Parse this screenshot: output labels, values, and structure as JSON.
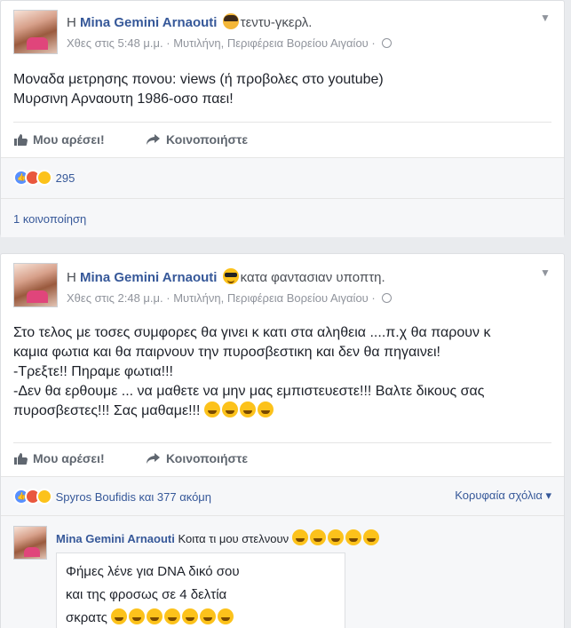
{
  "post1": {
    "author_prefix": "Η",
    "author": "Mina Gemini Arnaouti",
    "feeling_icon": "teddy-face-icon",
    "feeling": "τεντυ-γκερλ.",
    "time": "Χθες στις 5:48 μ.μ.",
    "sep": "·",
    "location": "Μυτιλήνη, Περιφέρεια Βορείου Αιγαίου",
    "sep2": "·",
    "body_line1": "Μοναδα μετρησης πονου: views (ή προβολες στο youtube)",
    "body_line2": "Μυρσινη Αρναουτη 1986-οσο παει!",
    "like_label": "Μου αρέσει!",
    "share_label": "Κοινοποιήστε",
    "reaction_count": "295",
    "shares": "1 κοινοποίηση"
  },
  "post2": {
    "author_prefix": "Η",
    "author": "Mina Gemini Arnaouti",
    "feeling_icon": "sunglasses-face-icon",
    "feeling": "κατα φαντασιαν υποπτη.",
    "time": "Χθες στις 2:48 μ.μ.",
    "sep": "·",
    "location": "Μυτιλήνη, Περιφέρεια Βορείου Αιγαίου",
    "sep2": "·",
    "body_line1": "Στο τελος με τοσες συμφορες θα γινει κ κατι στα αληθεια ....π.χ θα παρουν κ",
    "body_line2": "καμια φωτια και θα παιρνουν την πυροσβεστικη και δεν θα πηγαινει!",
    "body_line3": "-Τρεξτε!! Πηραμε φωτια!!!",
    "body_line4": "-Δεν θα ερθουμε ... να μαθετε να μην μας εμπιστευεστε!!! Βαλτε δικους σας",
    "body_line5": "πυροσβεστες!!! Σας μαθαμε!!!",
    "like_label": "Μου αρέσει!",
    "share_label": "Κοινοποιήστε",
    "reactors": "Spyros Boufidis και 377 ακόμη",
    "top_comments": "Κορυφαία σχόλια",
    "comment": {
      "author": "Mina Gemini Arnaouti",
      "text": "Κοιτα τι μου στελνουν",
      "image_line1": "Φήμες λένε για DNA δικό σου",
      "image_line2": "και της φροσως σε 4 δελτία",
      "image_line3": "σκρατς"
    }
  }
}
